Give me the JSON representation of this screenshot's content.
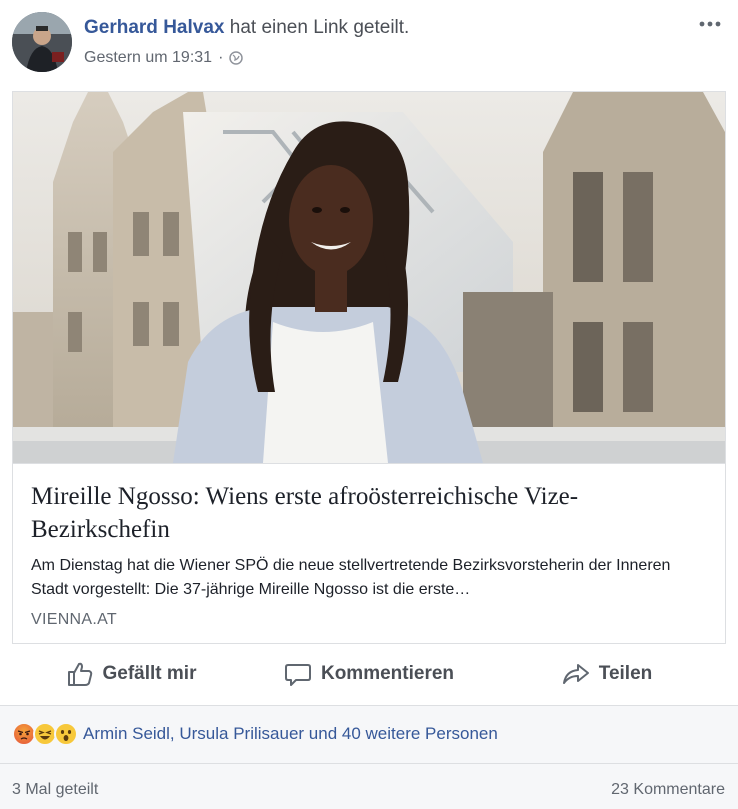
{
  "post": {
    "author": "Gerhard Halvax",
    "action_text": " hat einen Link geteilt.",
    "timestamp": "Gestern um 19:31",
    "separator": "·",
    "privacy_icon": "globe-icon",
    "more_icon": "more-options-icon"
  },
  "link": {
    "title": "Mireille Ngosso: Wiens erste afroösterreichische Vize-Bezirkschefin",
    "description": "Am Dienstag hat die Wiener SPÖ die neue stellvertretende Bezirksvorsteherin der Inneren Stadt vorgestellt: Die 37-jährige Mireille Ngosso ist die erste…",
    "domain": "VIENNA.AT"
  },
  "actions": {
    "like": "Gefällt mir",
    "comment": "Kommentieren",
    "share": "Teilen"
  },
  "reactions": {
    "icons": [
      "angry-reaction-icon",
      "haha-reaction-icon",
      "wow-reaction-icon"
    ],
    "names": "Armin Seidl, Ursula Prilisauer und 40 weitere Personen"
  },
  "stats": {
    "shares": "3 Mal geteilt",
    "comments": "23 Kommentare"
  },
  "colors": {
    "link_blue": "#365899",
    "secondary_text": "#616770",
    "border": "#dddfe2",
    "footer_bg": "#f6f7f9"
  }
}
